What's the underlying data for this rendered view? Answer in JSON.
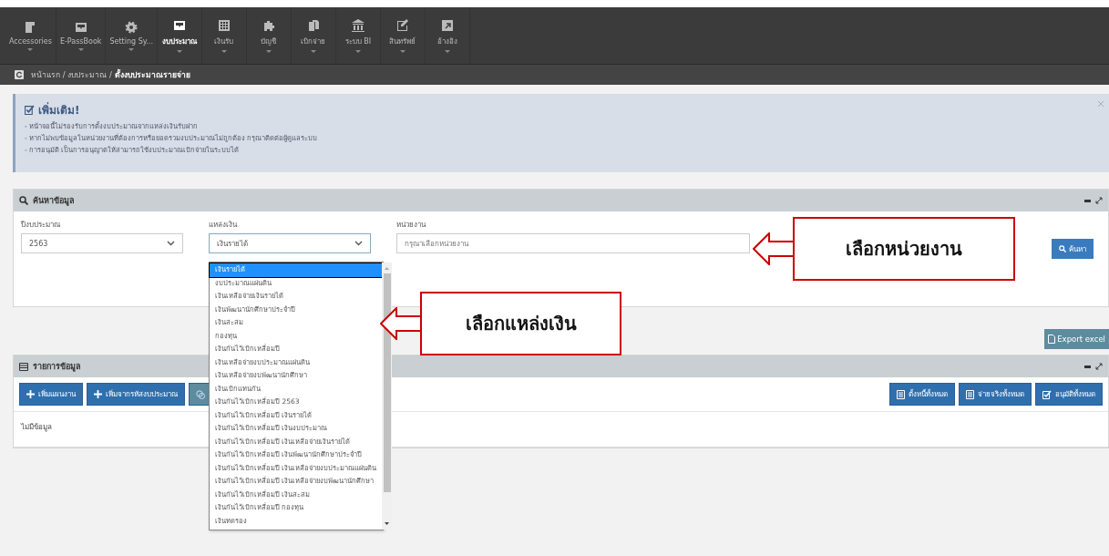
{
  "menu": [
    {
      "label": "Accessories",
      "selected": false
    },
    {
      "label": "E-PassBook",
      "selected": false
    },
    {
      "label": "Setting Sy...",
      "selected": false
    },
    {
      "label": "งบประมาณ",
      "selected": true
    },
    {
      "label": "เงินรับ",
      "selected": false
    },
    {
      "label": "บัญชี",
      "selected": false
    },
    {
      "label": "เบิกจ่าย",
      "selected": false
    },
    {
      "label": "ระบบ BI",
      "selected": false
    },
    {
      "label": "สินทรัพย์",
      "selected": false
    },
    {
      "label": "อ้างอิง",
      "selected": false
    }
  ],
  "breadcrumb": "หน้าแรก / งบประมาณ / **ตั้งงบประมาณรายจ่าย**",
  "info": {
    "title": "เพิ่มเติม!",
    "lines": [
      "- หน้าจอนี้ไม่รองรับการตั้งงบประมาณจากแหล่งเงินรับฝาก",
      "- หากไม่พบข้อมูลในหน่วยงานที่ต้องการหรือยอดรวมงบประมาณไม่ถูกต้อง กรุณาติดต่อผู้ดูแลระบบ",
      "- การอนุมัติ เป็นการอนุญาตให้สามารถใช้งบประมาณเบิกจ่ายในระบบได้"
    ]
  },
  "search_panel": {
    "title": "ค้นหาข้อมูล",
    "fiscal_year": {
      "label": "ปีงบประมาณ",
      "value": "2563"
    },
    "fund_source": {
      "label": "แหล่งเงิน",
      "value": "เงินรายได้",
      "options": [
        {
          "label": "เงินรายได้",
          "selected": true
        },
        {
          "label": "งบประมาณแผ่นดิน",
          "selected": false
        },
        {
          "label": "เงินเหลือจ่ายเงินรายได้",
          "selected": false
        },
        {
          "label": "เงินพัฒนานักศึกษาประจำปี",
          "selected": false
        },
        {
          "label": "เงินสะสม",
          "selected": false
        },
        {
          "label": "กองทุน",
          "selected": false
        },
        {
          "label": "เงินกันไว้เบิกเหลื่อมปี",
          "selected": false
        },
        {
          "label": "เงินเหลือจ่ายงบประมาณแผ่นดิน",
          "selected": false
        },
        {
          "label": "เงินเหลือจ่ายงบพัฒนานักศึกษา",
          "selected": false
        },
        {
          "label": "เงินเบิกแทนกัน",
          "selected": false
        },
        {
          "label": "เงินกันไว้เบิกเหลื่อมปี 2563",
          "selected": false
        },
        {
          "label": "เงินกันไว้เบิกเหลื่อมปี เงินรายได้",
          "selected": false
        },
        {
          "label": "เงินกันไว้เบิกเหลื่อมปี เงินงบประมาณ",
          "selected": false
        },
        {
          "label": "เงินกันไว้เบิกเหลื่อมปี เงินเหลือจ่ายเงินรายได้",
          "selected": false
        },
        {
          "label": "เงินกันไว้เบิกเหลื่อมปี เงินพัฒนานักศึกษาประจำปี",
          "selected": false
        },
        {
          "label": "เงินกันไว้เบิกเหลื่อมปี เงินเหลือจ่ายงบประมาณแผ่นดิน",
          "selected": false
        },
        {
          "label": "เงินกันไว้เบิกเหลื่อมปี เงินเหลือจ่ายงบพัฒนานักศึกษา",
          "selected": false
        },
        {
          "label": "เงินกันไว้เบิกเหลื่อมปี เงินสะสม",
          "selected": false
        },
        {
          "label": "เงินกันไว้เบิกเหลื่อมปี กองทุน",
          "selected": false
        },
        {
          "label": "เงินทดรอง",
          "selected": false
        }
      ]
    },
    "unit": {
      "label": "หน่วยงาน",
      "placeholder": "กรุณาเลือกหน่วยงาน"
    },
    "search_button": "ค้นหา"
  },
  "export_button": "Export excel",
  "list_panel": {
    "title": "รายการข้อมูล",
    "left_buttons": [
      {
        "label": "เพิ่มแผนงาน",
        "kind": "add"
      },
      {
        "label": "เพิ่มจากรหัสงบประมาณ",
        "kind": "add"
      },
      {
        "kind": "copy"
      }
    ],
    "right_buttons": [
      {
        "label": "ตั้งหนี้ทั้งหมด",
        "kind": "doc"
      },
      {
        "label": "จ่ายจริงทั้งหมด",
        "kind": "doc"
      },
      {
        "label": "อนุมัติทั้งหมด",
        "kind": "check"
      }
    ],
    "empty_text": "ไม่มีข้อมูล"
  },
  "callouts": [
    "เลือกหน่วยงาน",
    "เลือกแหล่งเงิน"
  ]
}
